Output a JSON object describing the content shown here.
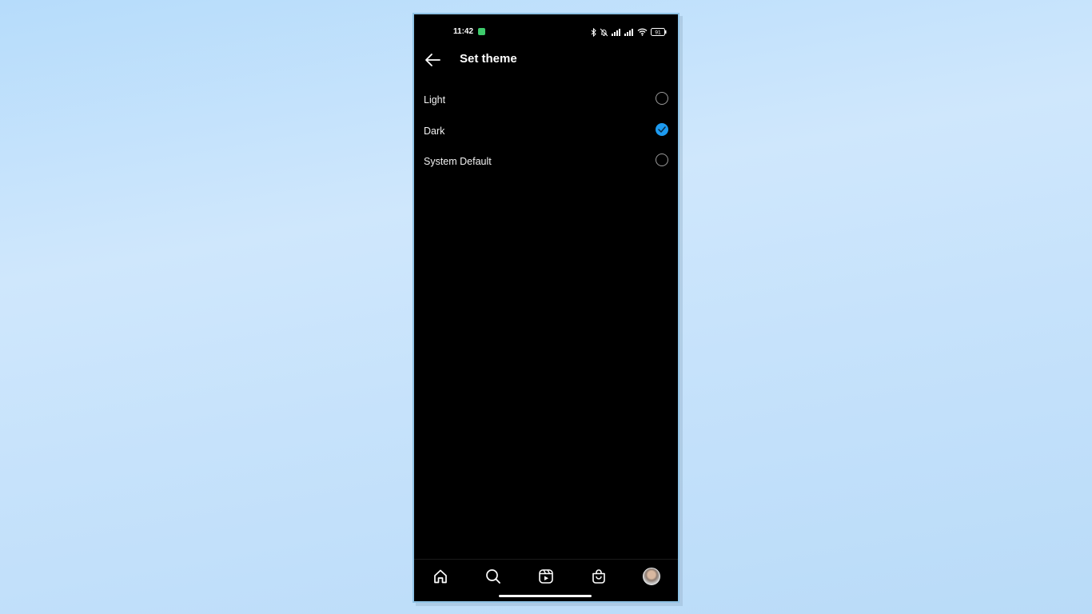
{
  "status_bar": {
    "time": "11:42",
    "battery": "91",
    "icons": [
      "whatsapp-notification-icon",
      "bluetooth-icon",
      "bell-off-icon",
      "signal-icon",
      "signal-icon",
      "wifi-icon",
      "battery-icon"
    ]
  },
  "header": {
    "back_icon": "arrow-left-icon",
    "title": "Set theme"
  },
  "theme_options": [
    {
      "label": "Light",
      "selected": false
    },
    {
      "label": "Dark",
      "selected": true
    },
    {
      "label": "System Default",
      "selected": false
    }
  ],
  "bottom_nav": [
    {
      "name": "home",
      "icon": "home-icon"
    },
    {
      "name": "search",
      "icon": "search-icon"
    },
    {
      "name": "reels",
      "icon": "reels-icon"
    },
    {
      "name": "shop",
      "icon": "shopping-bag-icon"
    },
    {
      "name": "profile",
      "icon": "avatar"
    }
  ],
  "colors": {
    "accent": "#1d9bf0",
    "background": "#000000",
    "text": "#ffffff"
  }
}
